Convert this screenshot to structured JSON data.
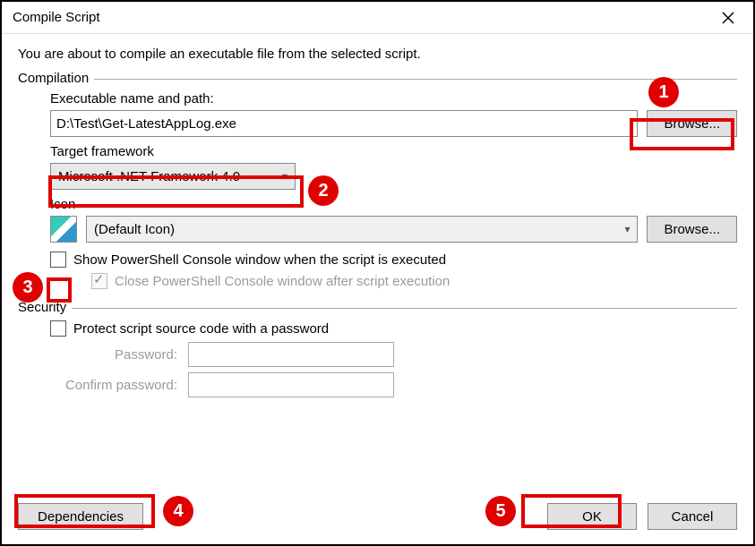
{
  "window": {
    "title": "Compile Script"
  },
  "intro": "You are about to compile an executable file from the selected script.",
  "compilation": {
    "legend": "Compilation",
    "exec_label": "Executable name and path:",
    "exec_value": "D:\\Test\\Get-LatestAppLog.exe",
    "browse1": "Browse...",
    "target_label": "Target framework",
    "target_value": "Microsoft .NET Framework 4.0",
    "icon_label": "Icon",
    "icon_value": "(Default Icon)",
    "browse2": "Browse...",
    "show_console": "Show PowerShell Console window when the script is executed",
    "close_console": "Close PowerShell Console window after script execution"
  },
  "security": {
    "legend": "Security",
    "protect": "Protect script source code with a password",
    "password_label": "Password:",
    "confirm_label": "Confirm password:"
  },
  "buttons": {
    "dependencies": "Dependencies",
    "ok": "OK",
    "cancel": "Cancel"
  },
  "annotations": {
    "n1": "1",
    "n2": "2",
    "n3": "3",
    "n4": "4",
    "n5": "5"
  }
}
